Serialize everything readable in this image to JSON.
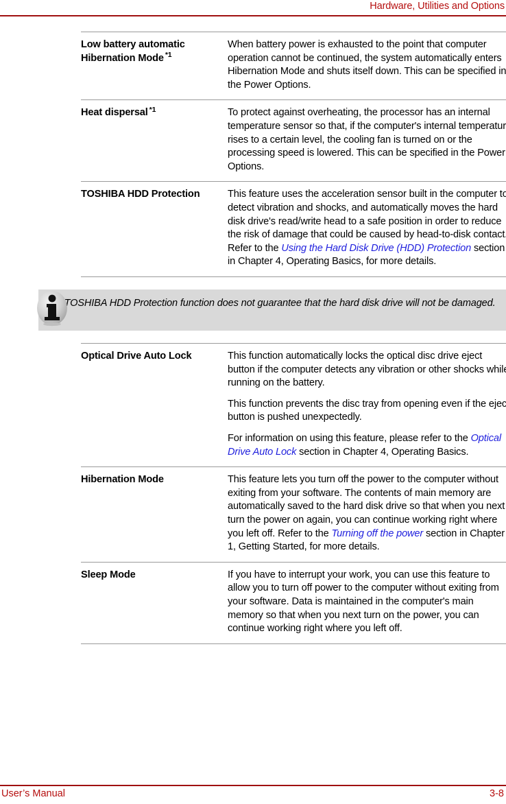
{
  "header": {
    "title": "Hardware, Utilities and Options",
    "accent_color": "#b50e0e"
  },
  "footer": {
    "left": "User’s Manual",
    "page_number": "3-8",
    "accent_color": "#b50e0e"
  },
  "colors": {
    "rule": "#9a9a9a",
    "xref_link": "#1f1fdd",
    "note_background": "#d9d9d9"
  },
  "table": {
    "rows": [
      {
        "term": "Low battery automatic Hibernation Mode",
        "term_footnote": "*1",
        "paragraphs": [
          {
            "parts": [
              {
                "text": "When battery power is exhausted to the point that computer operation cannot be continued, the system automatically enters Hibernation Mode and shuts itself down. This can be specified in the Power Options.",
                "style": "normal"
              }
            ]
          }
        ]
      },
      {
        "term": "Heat dispersal",
        "term_footnote": "*1",
        "paragraphs": [
          {
            "parts": [
              {
                "text": "To protect against overheating, the processor has an internal temperature sensor so that, if the computer's internal temperature rises to a certain level, the cooling fan is turned on or the processing speed is lowered. This can be specified in the Power Options.",
                "style": "normal"
              }
            ]
          }
        ]
      },
      {
        "term": "TOSHIBA HDD Protection",
        "term_footnote": "",
        "paragraphs": [
          {
            "parts": [
              {
                "text": "This feature uses the acceleration sensor built in the computer to detect vibration and shocks, and automatically moves the hard disk drive's read/write head to a safe position in order to reduce the risk of damage that could be caused by head-to-disk contact. Refer to the ",
                "style": "normal"
              },
              {
                "text": "Using the Hard Disk Drive (HDD) Protection",
                "style": "xref"
              },
              {
                "text": " section in Chapter 4, Operating Basics, for more details.",
                "style": "normal"
              }
            ]
          }
        ]
      }
    ]
  },
  "note": {
    "icon": "info-icon",
    "text": "The TOSHIBA HDD Protection function does not guarantee that the hard disk drive will not be damaged."
  },
  "table2": {
    "rows": [
      {
        "term": "Optical Drive Auto Lock",
        "term_footnote": "",
        "paragraphs": [
          {
            "parts": [
              {
                "text": "This function automatically locks the optical disc drive eject button if the computer detects any vibration or other shocks while running on the battery.",
                "style": "normal"
              }
            ]
          },
          {
            "parts": [
              {
                "text": "This function prevents the disc tray from opening even if the eject button is pushed unexpectedly.",
                "style": "normal"
              }
            ]
          },
          {
            "parts": [
              {
                "text": "For information on using this feature, please refer to the ",
                "style": "normal"
              },
              {
                "text": "Optical Drive Auto Lock",
                "style": "xref"
              },
              {
                "text": " section in Chapter 4, Operating Basics.",
                "style": "normal"
              }
            ]
          }
        ]
      },
      {
        "term": "Hibernation Mode",
        "term_footnote": "",
        "paragraphs": [
          {
            "parts": [
              {
                "text": "This feature lets you turn off the power to the computer without exiting from your software. The contents of main memory are automatically saved to the hard disk drive so that when you next turn the power on again, you can continue working right where you left off. Refer to the ",
                "style": "normal"
              },
              {
                "text": "Turning off the power",
                "style": "xref"
              },
              {
                "text": " section in Chapter 1, Getting Started, for more details.",
                "style": "normal"
              }
            ]
          }
        ]
      },
      {
        "term": "Sleep Mode",
        "term_footnote": "",
        "paragraphs": [
          {
            "parts": [
              {
                "text": "If you have to interrupt your work, you can use this feature to allow you to turn off power to the computer without exiting from your software. Data is maintained in the computer's main memory so that when you next turn on the power, you can continue working right where you left off.",
                "style": "normal"
              }
            ]
          }
        ]
      }
    ]
  }
}
